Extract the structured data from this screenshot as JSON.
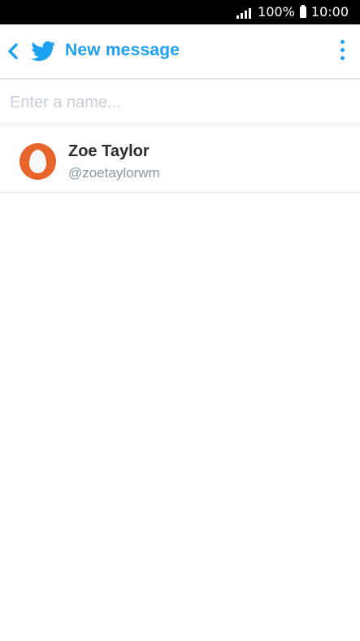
{
  "status_bar": {
    "battery_percent": "100%",
    "time": "10:00",
    "icons": [
      "signal-icon",
      "battery-icon"
    ]
  },
  "app_bar": {
    "title": "New message",
    "icons": [
      "back-arrow-icon",
      "twitter-bird-icon",
      "overflow-menu-icon"
    ]
  },
  "search": {
    "placeholder": "Enter a name..."
  },
  "results": [
    {
      "name": "Zoe Taylor",
      "handle": "@zoetaylorwm",
      "avatar_icon": "default-egg-avatar-icon"
    }
  ],
  "colors": {
    "accent": "#1da1f2",
    "avatar": "#e8642a",
    "status_bar": "#000000",
    "handle_text": "#8899a6"
  }
}
